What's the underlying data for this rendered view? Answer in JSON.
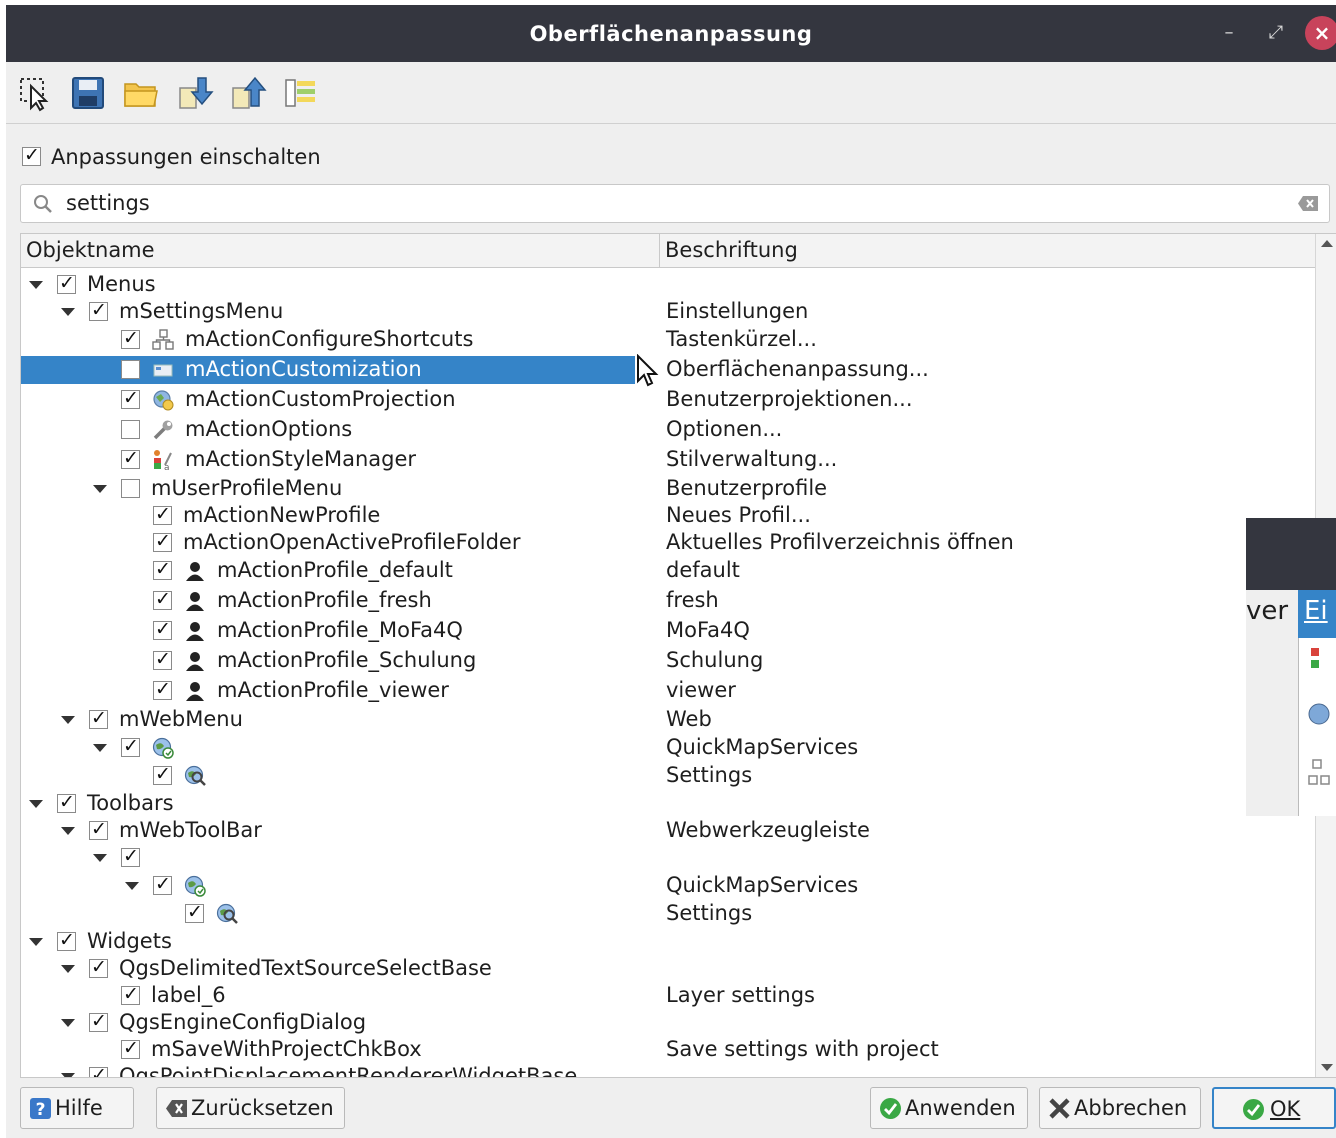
{
  "window": {
    "title": "Oberflächenanpassung",
    "minimize": "–",
    "maximize": "⤢",
    "close": "×"
  },
  "toolbar": {
    "icons": [
      "select-widget-icon",
      "save-icon",
      "open-folder-icon",
      "import-icon",
      "export-icon",
      "expand-all-icon"
    ]
  },
  "enable": {
    "label": "Anpassungen einschalten",
    "checked": true
  },
  "search": {
    "value": "settings",
    "icon": "search-icon"
  },
  "tree": {
    "headers": [
      "Objektname",
      "Beschriftung"
    ],
    "rows": [
      {
        "level": 0,
        "expander": true,
        "checked": true,
        "icon": "",
        "name": "Menus",
        "caption": ""
      },
      {
        "level": 1,
        "expander": true,
        "checked": true,
        "icon": "",
        "name": "mSettingsMenu",
        "caption": "Einstellungen"
      },
      {
        "level": 2,
        "expander": false,
        "checked": true,
        "icon": "shortcuts-icon",
        "name": "mActionConfigureShortcuts",
        "caption": "Tastenkürzel..."
      },
      {
        "level": 2,
        "expander": false,
        "checked": false,
        "icon": "customization-icon",
        "name": "mActionCustomization",
        "caption": "Oberflächenanpassung...",
        "selected": true
      },
      {
        "level": 2,
        "expander": false,
        "checked": true,
        "icon": "projection-icon",
        "name": "mActionCustomProjection",
        "caption": "Benutzerprojektionen..."
      },
      {
        "level": 2,
        "expander": false,
        "checked": false,
        "icon": "options-icon",
        "name": "mActionOptions",
        "caption": "Optionen..."
      },
      {
        "level": 2,
        "expander": false,
        "checked": true,
        "icon": "style-manager-icon",
        "name": "mActionStyleManager",
        "caption": "Stilverwaltung..."
      },
      {
        "level": 2,
        "expander": true,
        "checked": false,
        "icon": "",
        "name": "mUserProfileMenu",
        "caption": "Benutzerprofile"
      },
      {
        "level": 3,
        "expander": false,
        "checked": true,
        "icon": "",
        "name": "mActionNewProfile",
        "caption": "Neues Profil..."
      },
      {
        "level": 3,
        "expander": false,
        "checked": true,
        "icon": "",
        "name": "mActionOpenActiveProfileFolder",
        "caption": "Aktuelles Profilverzeichnis öffnen"
      },
      {
        "level": 3,
        "expander": false,
        "checked": true,
        "icon": "user-icon",
        "name": "mActionProfile_default",
        "caption": "default"
      },
      {
        "level": 3,
        "expander": false,
        "checked": true,
        "icon": "user-icon",
        "name": "mActionProfile_fresh",
        "caption": "fresh"
      },
      {
        "level": 3,
        "expander": false,
        "checked": true,
        "icon": "user-icon",
        "name": "mActionProfile_MoFa4Q",
        "caption": "MoFa4Q"
      },
      {
        "level": 3,
        "expander": false,
        "checked": true,
        "icon": "user-icon",
        "name": "mActionProfile_Schulung",
        "caption": "Schulung"
      },
      {
        "level": 3,
        "expander": false,
        "checked": true,
        "icon": "user-icon",
        "name": "mActionProfile_viewer",
        "caption": "viewer"
      },
      {
        "level": 1,
        "expander": true,
        "checked": true,
        "icon": "",
        "name": "mWebMenu",
        "caption": "Web"
      },
      {
        "level": 2,
        "expander": true,
        "checked": true,
        "icon": "quickmap-icon",
        "name": "",
        "caption": "QuickMapServices"
      },
      {
        "level": 3,
        "expander": false,
        "checked": true,
        "icon": "globe-search-icon",
        "name": "",
        "caption": "Settings"
      },
      {
        "level": 0,
        "expander": true,
        "checked": true,
        "icon": "",
        "name": "Toolbars",
        "caption": ""
      },
      {
        "level": 1,
        "expander": true,
        "checked": true,
        "icon": "",
        "name": "mWebToolBar",
        "caption": "Webwerkzeugleiste"
      },
      {
        "level": 2,
        "expander": true,
        "checked": true,
        "icon": "",
        "name": "",
        "caption": ""
      },
      {
        "level": 3,
        "expander": true,
        "checked": true,
        "icon": "quickmap-icon",
        "name": "",
        "caption": "QuickMapServices"
      },
      {
        "level": 4,
        "expander": false,
        "checked": true,
        "icon": "globe-search-icon",
        "name": "",
        "caption": "Settings"
      },
      {
        "level": 0,
        "expander": true,
        "checked": true,
        "icon": "",
        "name": "Widgets",
        "caption": ""
      },
      {
        "level": 1,
        "expander": true,
        "checked": true,
        "icon": "",
        "name": "QgsDelimitedTextSourceSelectBase",
        "caption": ""
      },
      {
        "level": 2,
        "expander": false,
        "checked": true,
        "icon": "",
        "name": "label_6",
        "caption": "Layer settings"
      },
      {
        "level": 1,
        "expander": true,
        "checked": true,
        "icon": "",
        "name": "QgsEngineConfigDialog",
        "caption": ""
      },
      {
        "level": 2,
        "expander": false,
        "checked": true,
        "icon": "",
        "name": "mSaveWithProjectChkBox",
        "caption": "Save settings with project"
      },
      {
        "level": 1,
        "expander": true,
        "checked": true,
        "icon": "",
        "name": "QgsPointDisplacementRendererWidgetBase",
        "caption": ""
      }
    ]
  },
  "buttons": {
    "help": "Hilfe",
    "reset": "Zurücksetzen",
    "apply": "Anwenden",
    "cancel": "Abbrechen",
    "ok": "OK"
  },
  "overlay": {
    "menu_left": "ver",
    "menu_right": "Ei"
  },
  "colors": {
    "titlebar": "#34363f",
    "selection": "#3584c8",
    "close": "#c8435b"
  }
}
